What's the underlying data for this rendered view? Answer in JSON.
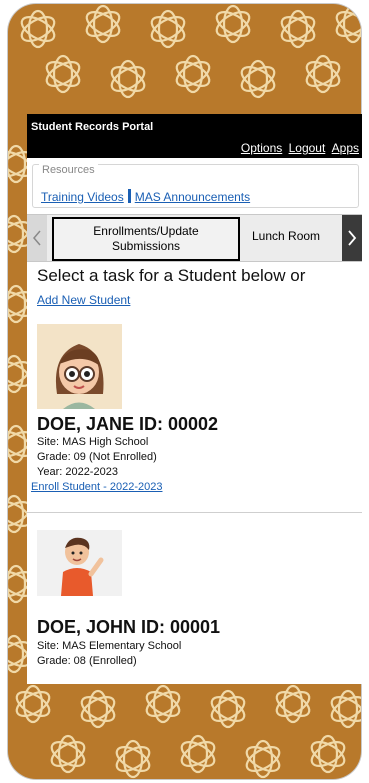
{
  "header": {
    "title": "Student Records Portal",
    "links": [
      "Options",
      "Logout",
      "Apps"
    ]
  },
  "resources": {
    "legend": "Resources",
    "links": [
      "Training Videos",
      "MAS Announcements"
    ]
  },
  "tabs": {
    "active_line1": "Enrollments/Update",
    "active_line2": "Submissions",
    "next": "Lunch Room"
  },
  "main": {
    "prompt": "Select a task for a Student below or",
    "add_link": "Add New Student"
  },
  "students": [
    {
      "name": "DOE, JANE ID: 00002",
      "site": "Site: MAS High School",
      "grade": "Grade: 09 (Not Enrolled)",
      "year": "Year: 2022-2023",
      "action": "Enroll Student - 2022-2023"
    },
    {
      "name": "DOE, JOHN ID: 00001",
      "site": "Site: MAS Elementary School",
      "grade": "Grade: 08 (Enrolled)"
    }
  ],
  "colors": {
    "frame_background": "#b8792b",
    "pattern_stroke": "#f0d9a8",
    "link": "#1a5fb4",
    "topbar": "#000000"
  },
  "icons": {
    "left_arrow": "chevron-left-icon",
    "right_arrow": "chevron-right-icon",
    "decor": "knot-pattern"
  }
}
